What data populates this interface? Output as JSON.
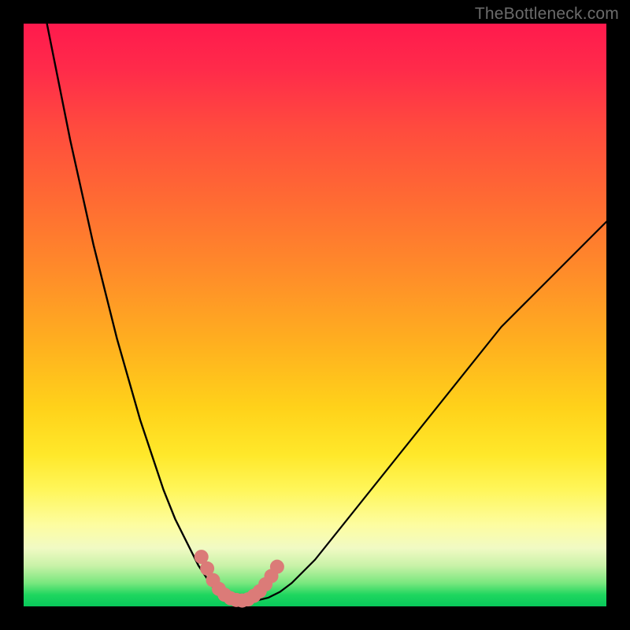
{
  "watermark": "TheBottleneck.com",
  "chart_data": {
    "type": "line",
    "title": "",
    "xlabel": "",
    "ylabel": "",
    "xlim": [
      0,
      100
    ],
    "ylim": [
      0,
      100
    ],
    "grid": false,
    "legend": false,
    "series": [
      {
        "name": "left-curve",
        "x": [
          4,
          6,
          8,
          10,
          12,
          14,
          16,
          18,
          20,
          22,
          24,
          26,
          28,
          30,
          32,
          33,
          34,
          35
        ],
        "y": [
          100,
          90,
          80,
          71,
          62,
          54,
          46,
          39,
          32,
          26,
          20,
          15,
          11,
          7,
          4,
          2.5,
          1.5,
          1
        ]
      },
      {
        "name": "right-curve",
        "x": [
          40,
          42,
          44,
          46,
          50,
          54,
          58,
          62,
          66,
          70,
          74,
          78,
          82,
          86,
          90,
          94,
          98,
          100
        ],
        "y": [
          1,
          1.5,
          2.5,
          4,
          8,
          13,
          18,
          23,
          28,
          33,
          38,
          43,
          48,
          52,
          56,
          60,
          64,
          66
        ]
      },
      {
        "name": "bottom-segment",
        "x": [
          33,
          34,
          35,
          36,
          37,
          38,
          39,
          40,
          41
        ],
        "y": [
          2.8,
          1.8,
          1.2,
          0.9,
          0.8,
          0.9,
          1.2,
          1.8,
          2.8
        ]
      }
    ],
    "markers": {
      "name": "highlight-dots",
      "color": "#db7b78",
      "points": [
        {
          "x": 30.5,
          "y": 8.5
        },
        {
          "x": 31.5,
          "y": 6.5
        },
        {
          "x": 32.5,
          "y": 4.5
        },
        {
          "x": 33.5,
          "y": 3.0
        },
        {
          "x": 34.5,
          "y": 2.0
        },
        {
          "x": 35.5,
          "y": 1.4
        },
        {
          "x": 36.5,
          "y": 1.1
        },
        {
          "x": 37.5,
          "y": 1.0
        },
        {
          "x": 38.5,
          "y": 1.2
        },
        {
          "x": 39.5,
          "y": 1.8
        },
        {
          "x": 40.5,
          "y": 2.6
        },
        {
          "x": 41.5,
          "y": 3.8
        },
        {
          "x": 42.5,
          "y": 5.2
        },
        {
          "x": 43.5,
          "y": 6.8
        }
      ]
    }
  }
}
